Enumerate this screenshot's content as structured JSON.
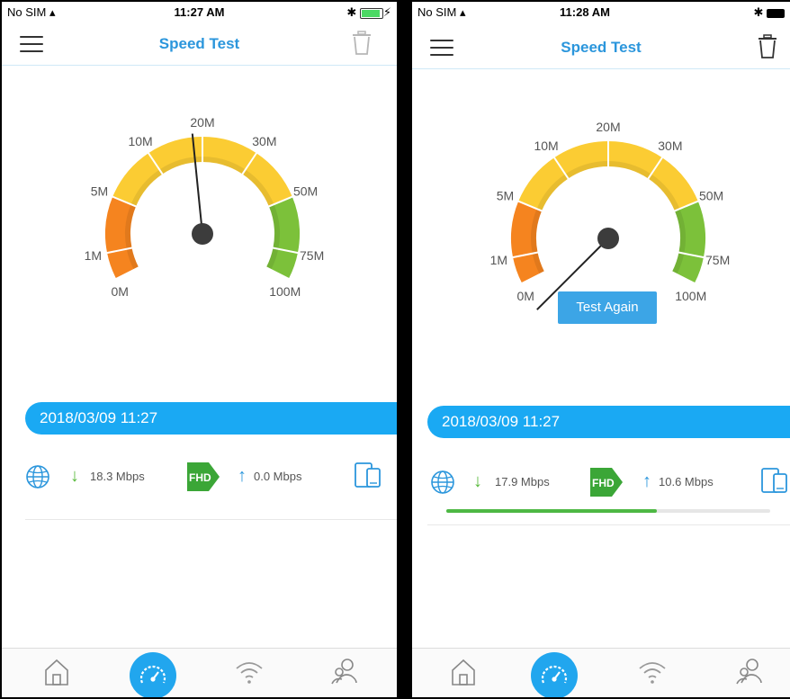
{
  "app_title": "Speed Test",
  "colors": {
    "accent": "#2b96dc",
    "date_bar": "#1aa9f3",
    "button": "#3ca5e6",
    "progress": "#4db844",
    "gauge_orange": "#f5841f",
    "gauge_yellow": "#fbcc33",
    "gauge_green": "#7cc13a"
  },
  "gauge_ticks": [
    "0M",
    "1M",
    "5M",
    "10M",
    "20M",
    "30M",
    "50M",
    "75M",
    "100M"
  ],
  "screens": [
    {
      "status": {
        "carrier": "No SIM",
        "time": "11:27 AM",
        "battery": "charging"
      },
      "trash_enabled": false,
      "needle_mbps": 18.3,
      "test_again": "",
      "result": {
        "date": "2018/03/09 11:27",
        "download": "18.3 Mbps",
        "quality": "FHD",
        "upload": "0.0 Mbps"
      }
    },
    {
      "status": {
        "carrier": "No SIM",
        "time": "11:28 AM",
        "battery": "full"
      },
      "trash_enabled": true,
      "needle_mbps": 0,
      "test_again": "Test Again",
      "upload_progress": 0.65,
      "result": {
        "date": "2018/03/09 11:27",
        "download": "17.9 Mbps",
        "quality": "FHD",
        "upload": "10.6 Mbps"
      }
    }
  ],
  "tabs": [
    {
      "icon": "home-icon"
    },
    {
      "icon": "speedometer-icon",
      "active": true
    },
    {
      "icon": "wifi-icon"
    },
    {
      "icon": "users-icon"
    }
  ]
}
